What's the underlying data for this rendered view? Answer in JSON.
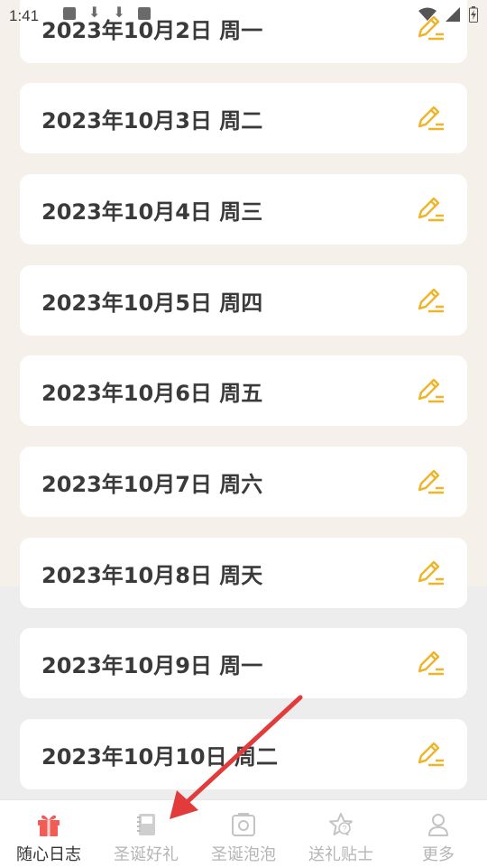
{
  "status": {
    "time": "1:41"
  },
  "entries": [
    {
      "date": "2023年10月2日 周一"
    },
    {
      "date": "2023年10月3日 周二"
    },
    {
      "date": "2023年10月4日 周三"
    },
    {
      "date": "2023年10月5日 周四"
    },
    {
      "date": "2023年10月6日 周五"
    },
    {
      "date": "2023年10月7日 周六"
    },
    {
      "date": "2023年10月8日 周天"
    },
    {
      "date": "2023年10月9日 周一"
    },
    {
      "date": "2023年10月10日 周二"
    }
  ],
  "tabs": [
    {
      "label": "随心日志",
      "icon": "gift-icon",
      "active": true
    },
    {
      "label": "圣诞好礼",
      "icon": "notebook-icon",
      "active": false
    },
    {
      "label": "圣诞泡泡",
      "icon": "camera-frame-icon",
      "active": false
    },
    {
      "label": "送礼贴士",
      "icon": "star-question-icon",
      "active": false
    },
    {
      "label": "更多",
      "icon": "person-icon",
      "active": false
    }
  ],
  "colors": {
    "accent_orange": "#f0b429",
    "gift_red": "#f25c54",
    "annotation_arrow": "#e23b3b"
  }
}
